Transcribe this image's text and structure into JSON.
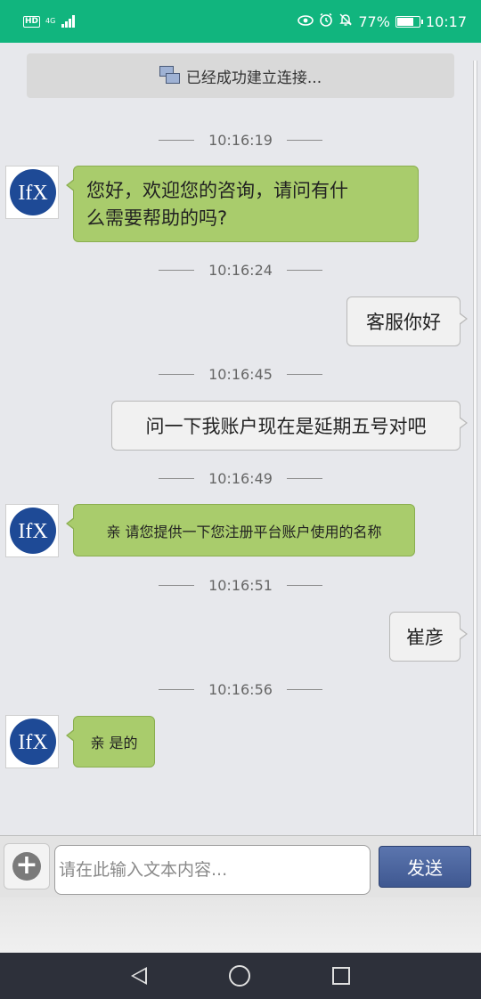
{
  "status_bar": {
    "hd_label": "HD",
    "network_label": "4G",
    "battery_percent": "77%",
    "battery_level": 0.77,
    "time": "10:17",
    "icons": [
      "hd-icon",
      "signal-icon",
      "eye-icon",
      "alarm-icon",
      "mute-bell-icon",
      "battery-icon"
    ]
  },
  "connection": {
    "text": "已经成功建立连接..."
  },
  "messages": [
    {
      "time": "10:16:19",
      "side": "left",
      "text": "您好，欢迎您的咨询，请问有什么需要帮助的吗?",
      "lines": [
        "您好，欢迎您的咨询，请问有什",
        "么需要帮助的吗?"
      ]
    },
    {
      "time": "10:16:24",
      "side": "right",
      "text": "客服你好"
    },
    {
      "time": "10:16:45",
      "side": "right",
      "text": "问一下我账户现在是延期五号对吧"
    },
    {
      "time": "10:16:49",
      "side": "left",
      "text": "亲 请您提供一下您注册平台账户使用的名称"
    },
    {
      "time": "10:16:51",
      "side": "right",
      "text": "崔彦"
    },
    {
      "time": "10:16:56",
      "side": "left",
      "text": "亲 是的"
    }
  ],
  "avatar_logo_text": "IfX",
  "input": {
    "placeholder": "请在此输入文本内容...",
    "value": ""
  },
  "send_label": "发送",
  "nav": {
    "icons": [
      "back-icon",
      "home-icon",
      "recent-apps-icon"
    ]
  },
  "colors": {
    "status_bar": "#11b57e",
    "agent_bubble": "#a9cc6c",
    "user_bubble": "#f1f1f1",
    "send_button": "#4a649e",
    "nav_bar": "#2d303a"
  }
}
